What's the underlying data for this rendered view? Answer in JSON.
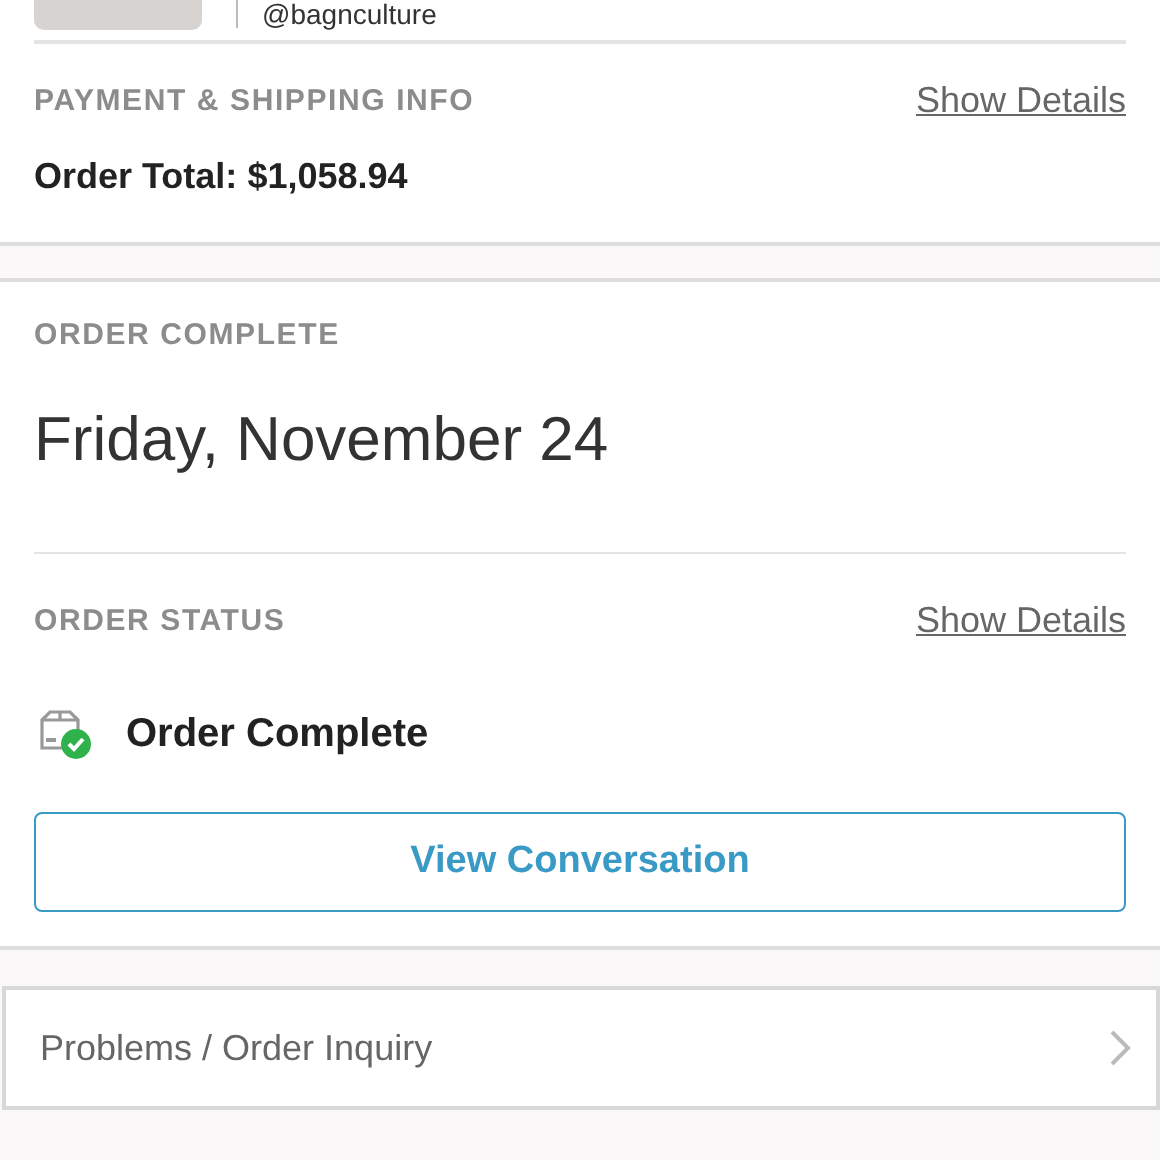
{
  "seller": {
    "handle": "@bagnculture"
  },
  "payment": {
    "heading": "PAYMENT & SHIPPING INFO",
    "link": "Show Details",
    "total_label": "Order Total:",
    "total": "$1,058.94"
  },
  "order": {
    "heading": "ORDER COMPLETE",
    "date": "Friday, November 24"
  },
  "status": {
    "heading": "ORDER STATUS",
    "link": "Show Details",
    "text": "Order Complete",
    "complete": true,
    "button": "View Conversation"
  },
  "inquiry": {
    "label": "Problems / Order Inquiry"
  }
}
